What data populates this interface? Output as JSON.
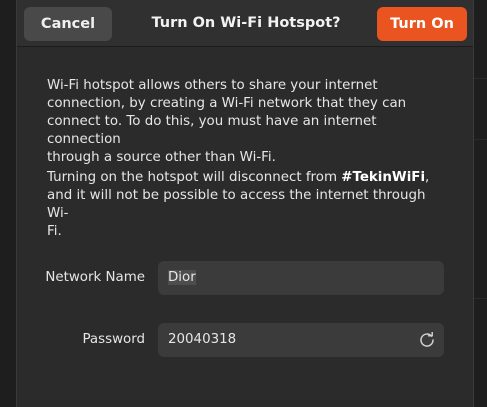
{
  "header": {
    "cancel_label": "Cancel",
    "title": "Turn On Wi-Fi Hotspot?",
    "confirm_label": "Turn On"
  },
  "body": {
    "para1_lines": [
      "Wi-Fi hotspot allows others to share your internet",
      "connection, by creating a Wi-Fi network that they can",
      "connect to. To do this, you must have an internet connection",
      "through a source other than Wi-Fi."
    ],
    "para2_line1_prefix": "Turning on the hotspot will disconnect from ",
    "para2_network": "#TekinWiFi",
    "para2_line1_suffix": ",",
    "para2_line2": "and it will not be possible to access the internet through Wi-",
    "para2_line3": "Fi."
  },
  "form": {
    "network_name_label": "Network Name",
    "network_name_value": "Dior",
    "password_label": "Password",
    "password_value": "20040318"
  },
  "icons": {
    "refresh": "refresh-icon"
  },
  "colors": {
    "accent": "#e95420",
    "dialog_bg": "#2b2b2b",
    "field_bg": "#3b3b3b"
  }
}
